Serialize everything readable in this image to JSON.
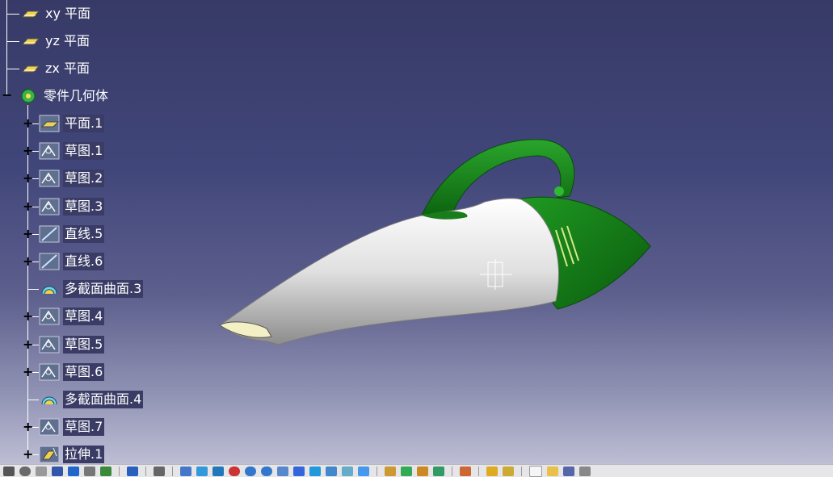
{
  "tree": {
    "planes": [
      {
        "label": "xy 平面",
        "icon": "plane-icon"
      },
      {
        "label": "yz 平面",
        "icon": "plane-icon"
      },
      {
        "label": "zx 平面",
        "icon": "plane-icon"
      }
    ],
    "body": {
      "label": "零件几何体",
      "icon": "part-body-icon"
    },
    "features": [
      {
        "label": "平面.1",
        "icon": "plane-feature-icon",
        "expandable": true
      },
      {
        "label": "草图.1",
        "icon": "sketch-icon",
        "expandable": true
      },
      {
        "label": "草图.2",
        "icon": "sketch-icon",
        "expandable": true
      },
      {
        "label": "草图.3",
        "icon": "sketch-icon",
        "expandable": true
      },
      {
        "label": "直线.5",
        "icon": "line-icon",
        "expandable": true
      },
      {
        "label": "直线.6",
        "icon": "line-icon",
        "expandable": true
      },
      {
        "label": "多截面曲面.3",
        "icon": "multi-section-surface-icon",
        "expandable": false
      },
      {
        "label": "草图.4",
        "icon": "sketch-icon",
        "expandable": true
      },
      {
        "label": "草图.5",
        "icon": "sketch-icon",
        "expandable": true
      },
      {
        "label": "草图.6",
        "icon": "sketch-icon",
        "expandable": true
      },
      {
        "label": "多截面曲面.4",
        "icon": "multi-section-surface-icon",
        "expandable": false
      },
      {
        "label": "草图.7",
        "icon": "sketch-icon",
        "expandable": true
      },
      {
        "label": "拉伸.1",
        "icon": "extrude-icon",
        "expandable": true
      }
    ]
  },
  "colors": {
    "model_green": "#157a16",
    "model_white": "#e4e4e4",
    "background_top": "#373a66",
    "background_bottom": "#c5c6da"
  }
}
